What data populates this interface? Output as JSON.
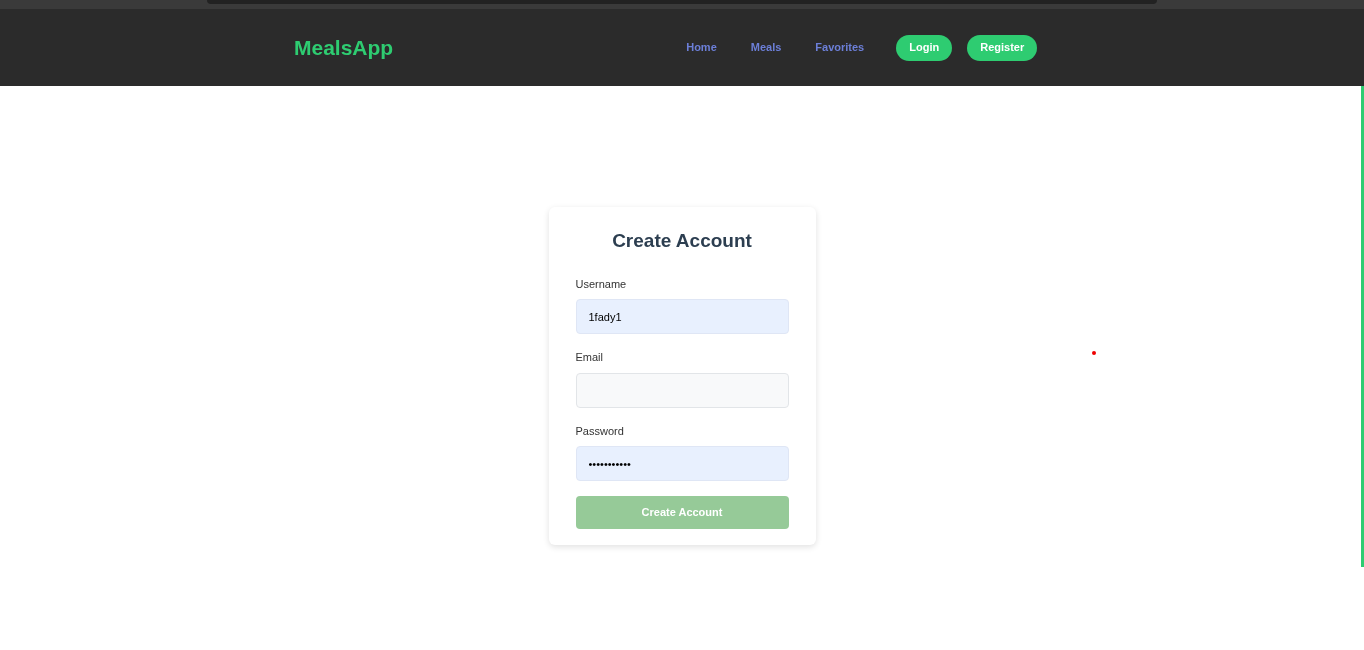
{
  "navbar": {
    "brand": "MealsApp",
    "links": [
      "Home",
      "Meals",
      "Favorites"
    ],
    "buttons": [
      "Login",
      "Register"
    ]
  },
  "form": {
    "title": "Create Account",
    "fields": [
      {
        "label": "Username",
        "value": "1fady1",
        "autofilled": true
      },
      {
        "label": "Email",
        "autofilled": false
      },
      {
        "label": "Password",
        "value": "•••••••••••",
        "autofilled": true
      }
    ],
    "submit": {
      "label": "Create Account",
      "disabled": true
    }
  }
}
